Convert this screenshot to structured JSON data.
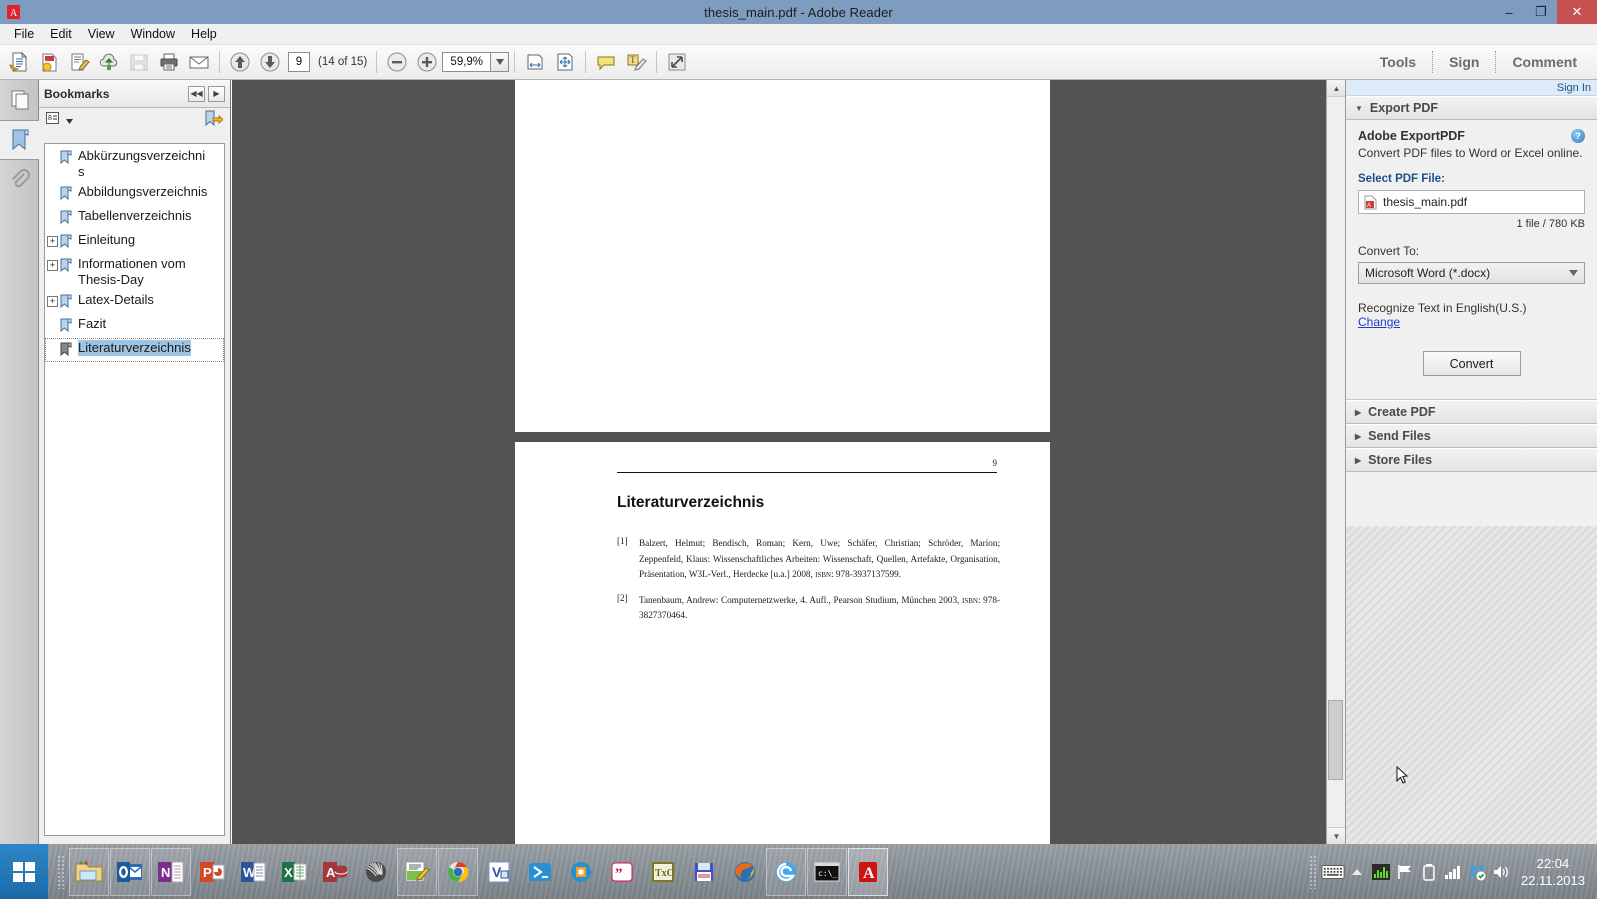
{
  "window": {
    "title": "thesis_main.pdf - Adobe Reader",
    "app_icon": "adobe-reader-icon",
    "minimize": "–",
    "restore": "❐",
    "close": "✕"
  },
  "menubar": {
    "items": [
      "File",
      "Edit",
      "View",
      "Window",
      "Help"
    ]
  },
  "toolbar": {
    "icons": [
      {
        "name": "open-file-icon"
      },
      {
        "name": "create-pdf-icon"
      },
      {
        "name": "edit-pdf-icon"
      },
      {
        "name": "upload-cloud-icon"
      },
      {
        "name": "save-icon"
      },
      {
        "name": "print-icon"
      },
      {
        "name": "email-icon"
      },
      {
        "name": "previous-page-icon"
      },
      {
        "name": "next-page-icon"
      }
    ],
    "page_number": "9",
    "page_count": "(14 of 15)",
    "zoom_out": "−",
    "zoom_in": "+",
    "zoom_value": "59,9%",
    "zoom_dropdown_caret": "▼",
    "fit_width_icon": "fit-width-icon",
    "fit_page_icon": "fit-page-icon",
    "comment_icon": "sticky-note-icon",
    "highlight_icon": "highlight-text-icon",
    "fullscreen_icon": "fullscreen-icon",
    "right_items": [
      "Tools",
      "Sign",
      "Comment"
    ]
  },
  "navrail": {
    "items": [
      {
        "name": "page-thumbnails-icon",
        "label": "Page Thumbnails"
      },
      {
        "name": "bookmarks-icon",
        "label": "Bookmarks"
      },
      {
        "name": "attachments-icon",
        "label": "Attachments"
      }
    ]
  },
  "bookmarks": {
    "title": "Bookmarks",
    "nav_prev": "◀◀",
    "nav_next": "▶",
    "options_icon": "options-menu-icon",
    "new_bookmark_icon": "new-bookmark-icon",
    "items": [
      {
        "label": "Abkürzungsverzeichnis",
        "expandable": false,
        "selected": false
      },
      {
        "label": "Abbildungsverzeichnis",
        "expandable": false,
        "selected": false
      },
      {
        "label": "Tabellenverzeichnis",
        "expandable": false,
        "selected": false
      },
      {
        "label": "Einleitung",
        "expandable": true,
        "selected": false
      },
      {
        "label": "Informationen vom Thesis-Day",
        "expandable": true,
        "selected": false
      },
      {
        "label": "Latex-Details",
        "expandable": true,
        "selected": false
      },
      {
        "label": "Fazit",
        "expandable": false,
        "selected": false
      },
      {
        "label": "Literaturverzeichnis",
        "expandable": false,
        "selected": true
      }
    ],
    "expand_glyph": "+"
  },
  "document": {
    "page_number_label": "9",
    "heading": "Literaturverzeichnis",
    "bibliography": [
      {
        "key": "[1]",
        "text": "Balzert, Helmut; Bendisch, Roman; Kern, Uwe; Schäfer, Christian; Schröder, Marion; Zeppenfeld, Klaus: Wissenschaftliches Arbeiten: Wissenschaft, Quellen, Artefakte, Organisation, Präsentation, W3L-Verl., Herdecke [u.a.] 2008, ",
        "isbn_label": "isbn",
        "isbn_value": ": 978-3937137599."
      },
      {
        "key": "[2]",
        "text": "Tanenbaum, Andrew: Computernetzwerke, 4. Aufl., Pearson Studium, München 2003, ",
        "isbn_label": "isbn",
        "isbn_value": ": 978-3827370464."
      }
    ]
  },
  "right_panel": {
    "sign_in": "Sign In",
    "sections": [
      {
        "title": "Export PDF",
        "expanded": true
      },
      {
        "title": "Create PDF",
        "expanded": false
      },
      {
        "title": "Send Files",
        "expanded": false
      },
      {
        "title": "Store Files",
        "expanded": false
      }
    ],
    "export": {
      "app_name": "Adobe ExportPDF",
      "description": "Convert PDF files to Word or Excel online.",
      "help_icon": "help-icon",
      "help_glyph": "?",
      "select_label": "Select PDF File:",
      "file_name": "thesis_main.pdf",
      "file_icon": "pdf-file-icon",
      "file_meta": "1 file / 780 KB",
      "convert_to_label": "Convert To:",
      "convert_to_value": "Microsoft Word (*.docx)",
      "convert_to_options": [
        "Microsoft Word (*.docx)"
      ],
      "ocr_text": "Recognize Text in English(U.S.)",
      "change_link": "Change",
      "convert_button": "Convert"
    },
    "expanded_glyph": "▼",
    "collapsed_glyph": "▶"
  },
  "scrollbar": {
    "up_glyph": "▲",
    "down_glyph": "▼"
  },
  "taskbar": {
    "start_icon": "windows-start-icon",
    "items": [
      {
        "name": "taskbar-file-explorer",
        "label": "File Explorer",
        "pinned": true
      },
      {
        "name": "taskbar-outlook",
        "label": "Outlook",
        "pinned": true
      },
      {
        "name": "taskbar-onenote",
        "label": "OneNote",
        "pinned": true
      },
      {
        "name": "taskbar-powerpoint",
        "label": "PowerPoint",
        "pinned": false
      },
      {
        "name": "taskbar-word",
        "label": "Word",
        "pinned": false
      },
      {
        "name": "taskbar-excel",
        "label": "Excel",
        "pinned": false
      },
      {
        "name": "taskbar-access",
        "label": "Access",
        "pinned": false
      },
      {
        "name": "taskbar-matlab",
        "label": "MATLAB",
        "pinned": false
      },
      {
        "name": "taskbar-notepadpp",
        "label": "Notepad++",
        "pinned": true
      },
      {
        "name": "taskbar-chrome",
        "label": "Google Chrome",
        "pinned": true
      },
      {
        "name": "taskbar-visio",
        "label": "Visio",
        "pinned": false
      },
      {
        "name": "taskbar-powershell",
        "label": "PowerShell",
        "pinned": false
      },
      {
        "name": "taskbar-groove",
        "label": "Office Groove",
        "pinned": false
      },
      {
        "name": "taskbar-citavi",
        "label": "Citavi",
        "pinned": false
      },
      {
        "name": "taskbar-texstudio",
        "label": "TeXnicCenter",
        "pinned": false
      },
      {
        "name": "taskbar-floppy",
        "label": "Save Tool",
        "pinned": false
      },
      {
        "name": "taskbar-firefox",
        "label": "Mozilla Firefox",
        "pinned": false
      },
      {
        "name": "taskbar-ie",
        "label": "Internet Explorer",
        "pinned": true
      },
      {
        "name": "taskbar-cmd",
        "label": "Command Prompt",
        "pinned": true
      },
      {
        "name": "taskbar-adobe-reader",
        "label": "Adobe Reader",
        "pinned": true
      }
    ],
    "tray": [
      {
        "name": "keyboard-icon"
      },
      {
        "name": "show-hidden-icons-icon",
        "glyph": "▲"
      },
      {
        "name": "network-monitor-icon"
      },
      {
        "name": "flag-action-center-icon"
      },
      {
        "name": "battery-icon"
      },
      {
        "name": "signal-bars-icon"
      },
      {
        "name": "dropbox-icon"
      },
      {
        "name": "volume-icon"
      }
    ],
    "clock_time": "22:04",
    "clock_date": "22.11.2013"
  }
}
